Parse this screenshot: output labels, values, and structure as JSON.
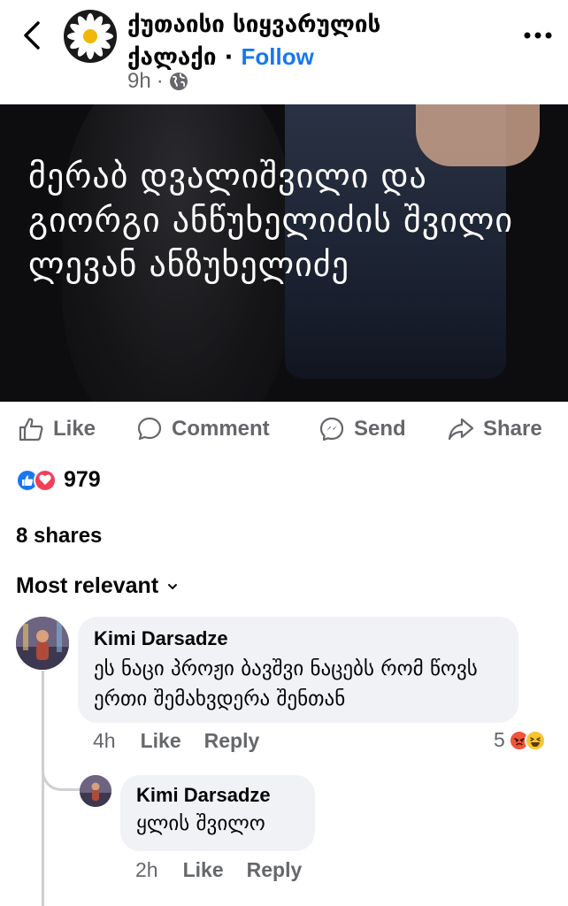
{
  "header": {
    "page_name_line1": "ქუთაისი სიყვარულის",
    "page_name_line2": "ქალაქი",
    "separator": "·",
    "follow_label": "Follow",
    "time": "9h",
    "meta_separator": "·",
    "privacy_icon": "globe-icon"
  },
  "post": {
    "image_caption": "მერაბ დვალიშვილი და გიორგი ანწუხელიძის შვილი ლევან ანზუხელიძე"
  },
  "actions": {
    "like_label": "Like",
    "comment_label": "Comment",
    "send_label": "Send",
    "share_label": "Share"
  },
  "reactions": {
    "count": "979",
    "types": [
      "like-icon",
      "love-icon"
    ]
  },
  "shares": {
    "label": "8 shares"
  },
  "sort": {
    "label": "Most relevant"
  },
  "comments": [
    {
      "author": "Kimi Darsadze",
      "text": "ეს ნაცი პროჟი ბავშვი ნაცებს რომ წოვს ერთი შემახვდერა შენთან",
      "time": "4h",
      "like_label": "Like",
      "reply_label": "Reply",
      "reaction_count": "5",
      "reaction_types": [
        "angry-icon",
        "haha-icon"
      ]
    },
    {
      "author": "Kimi Darsadze",
      "text": "ყლის შვილო",
      "time": "2h",
      "like_label": "Like",
      "reply_label": "Reply"
    }
  ],
  "colors": {
    "accent": "#1877f2",
    "muted": "#65676b",
    "bubble": "#f0f2f5",
    "love": "#f33e58"
  }
}
